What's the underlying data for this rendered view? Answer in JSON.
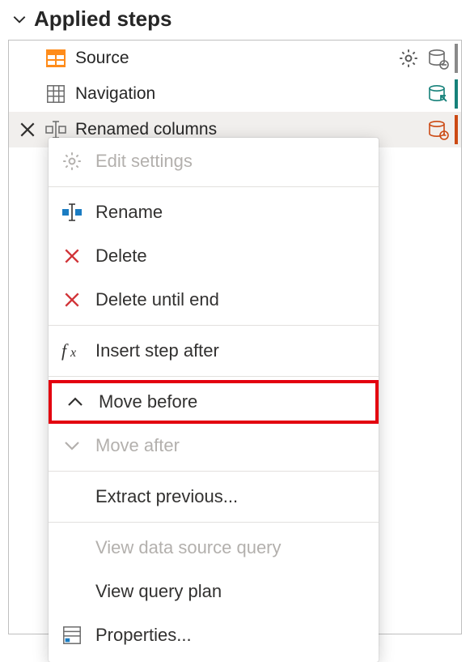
{
  "section": {
    "title": "Applied steps"
  },
  "steps": [
    {
      "label": "Source"
    },
    {
      "label": "Navigation"
    },
    {
      "label": "Renamed columns"
    }
  ],
  "menu": {
    "edit_settings": "Edit settings",
    "rename": "Rename",
    "delete": "Delete",
    "delete_until_end": "Delete until end",
    "insert_step_after": "Insert step after",
    "move_before": "Move before",
    "move_after": "Move after",
    "extract_previous": "Extract previous...",
    "view_data_source_query": "View data source query",
    "view_query_plan": "View query plan",
    "properties": "Properties..."
  }
}
